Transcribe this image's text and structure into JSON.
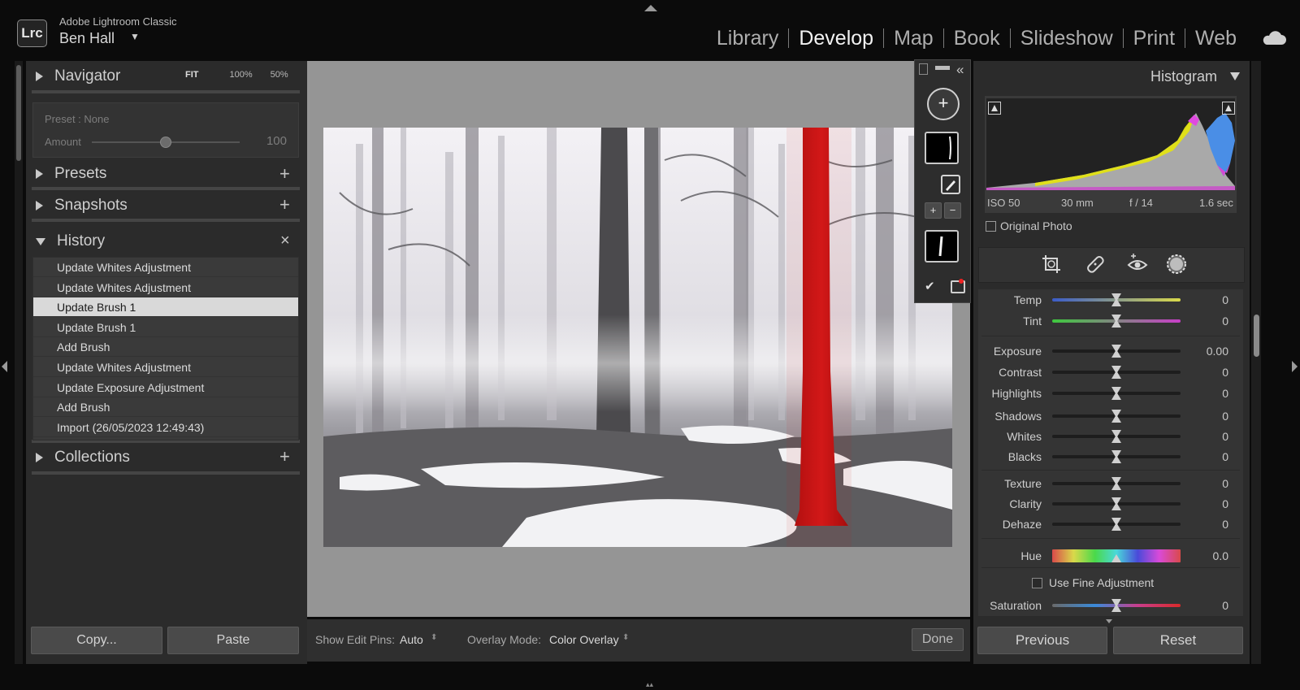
{
  "app": {
    "logo": "Lrc",
    "name": "Adobe Lightroom Classic",
    "user": "Ben Hall",
    "user_caret": "▼"
  },
  "modules": [
    "Library",
    "Develop",
    "Map",
    "Book",
    "Slideshow",
    "Print",
    "Web"
  ],
  "active_module": "Develop",
  "left": {
    "navigator": {
      "title": "Navigator",
      "zoom": [
        "FIT",
        "100%",
        "50%"
      ]
    },
    "preset_label": "Preset : None",
    "amount_label": "Amount",
    "amount_value": "100",
    "presets_title": "Presets",
    "snapshots_title": "Snapshots",
    "history_title": "History",
    "history": [
      "Update Whites Adjustment",
      "Update Whites Adjustment",
      "Update Brush 1",
      "Update Brush 1",
      "Add Brush",
      "Update Whites Adjustment",
      "Update Exposure Adjustment",
      "Add Brush",
      "Import (26/05/2023 12:49:43)"
    ],
    "history_selected": 2,
    "collections_title": "Collections",
    "copy_label": "Copy...",
    "paste_label": "Paste"
  },
  "toolbar": {
    "edit_pins_label": "Show Edit Pins:",
    "edit_pins_value": "Auto",
    "overlay_label": "Overlay Mode:",
    "overlay_value": "Color Overlay",
    "done_label": "Done"
  },
  "right": {
    "histogram_title": "Histogram",
    "exif": {
      "iso": "ISO 50",
      "focal": "30 mm",
      "aperture": "f / 14",
      "shutter": "1.6 sec"
    },
    "original_photo_label": "Original Photo",
    "sliders": [
      {
        "label": "Temp",
        "value": "0",
        "level": 0.5
      },
      {
        "label": "Tint",
        "value": "0",
        "level": 0.5
      },
      {
        "label": "Exposure",
        "value": "0.00",
        "level": 0.5
      },
      {
        "label": "Contrast",
        "value": "0",
        "level": 0.5
      },
      {
        "label": "Highlights",
        "value": "0",
        "level": 0.5
      },
      {
        "label": "Shadows",
        "value": "0",
        "level": 0.5
      },
      {
        "label": "Whites",
        "value": "0",
        "level": 0.5
      },
      {
        "label": "Blacks",
        "value": "0",
        "level": 0.5
      },
      {
        "label": "Texture",
        "value": "0",
        "level": 0.5
      },
      {
        "label": "Clarity",
        "value": "0",
        "level": 0.5
      },
      {
        "label": "Dehaze",
        "value": "0",
        "level": 0.5
      },
      {
        "label": "Hue",
        "value": "0.0",
        "level": 0.5
      },
      {
        "label": "Saturation",
        "value": "0",
        "level": 0.5
      }
    ],
    "fine_adjust_label": "Use Fine Adjustment",
    "previous_label": "Previous",
    "reset_label": "Reset"
  },
  "colors": {
    "mask_overlay": "#c81414",
    "selected_row": "#d9d9d9",
    "center_bg": "#959595"
  }
}
